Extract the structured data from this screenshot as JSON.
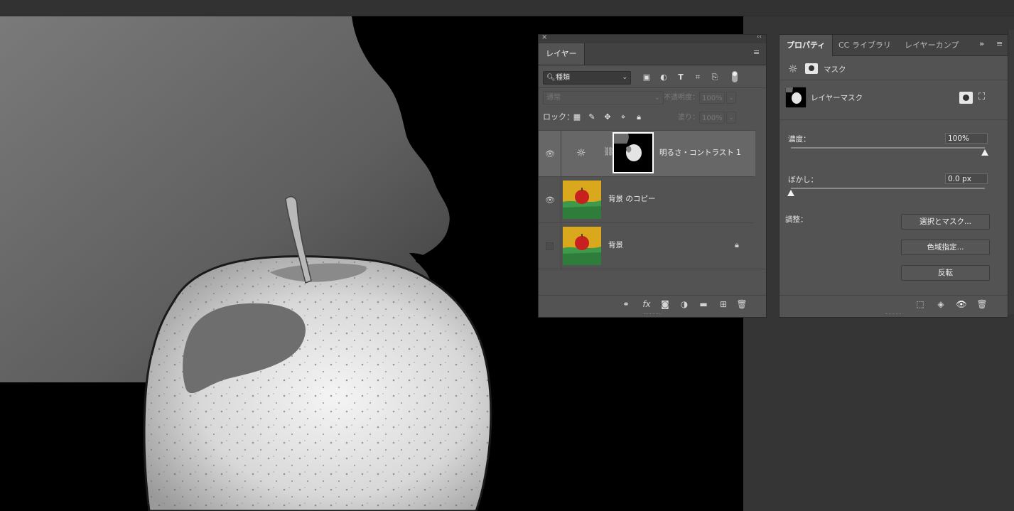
{
  "layers_panel": {
    "tab": "レイヤー",
    "kind_filter": "種類",
    "blend_mode": "通常",
    "opacity_label": "不透明度：",
    "opacity_value": "100%",
    "lock_label": "ロック：",
    "fill_label": "塗り：",
    "fill_value": "100%",
    "layers": [
      {
        "name": "明るさ・コントラスト 1",
        "visible": true,
        "selected": true,
        "type": "adjustment"
      },
      {
        "name": "背景 のコピー",
        "visible": true,
        "selected": false,
        "type": "image"
      },
      {
        "name": "背景",
        "visible": false,
        "selected": false,
        "type": "image",
        "locked": true
      }
    ]
  },
  "properties_panel": {
    "tabs": [
      "プロパティ",
      "CC ライブラリ",
      "レイヤーカンプ"
    ],
    "expand_label": "»",
    "header_label": "マスク",
    "mask_name": "レイヤーマスク",
    "density_label": "濃度：",
    "density_value": "100%",
    "density_fraction": 1.0,
    "feather_label": "ぼかし：",
    "feather_value": "0.0 px",
    "feather_fraction": 0.0,
    "adjust_label": "調整：",
    "buttons": [
      "選択とマスク...",
      "色域指定...",
      "反転"
    ]
  },
  "colors": {
    "panel_bg": "#535353",
    "selected_row": "#676767",
    "canvas_bg": "#000000"
  }
}
